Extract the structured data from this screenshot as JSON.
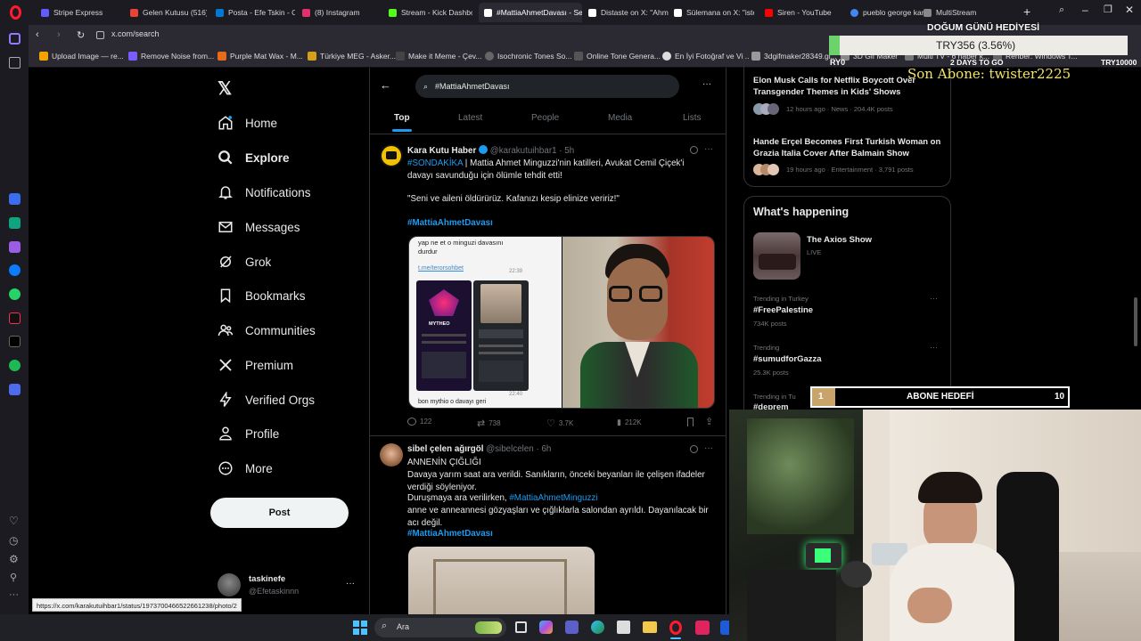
{
  "browser": {
    "tabs": [
      {
        "label": "Stripe Express",
        "color": "#635bff"
      },
      {
        "label": "Gelen Kutusu (516) -",
        "color": "#ea4335"
      },
      {
        "label": "Posta - Efe Tskin - Ou",
        "color": "#0078d4"
      },
      {
        "label": "(8) Instagram",
        "color": "#e1306c"
      },
      {
        "label": "Stream - Kick Dashbo",
        "color": "#53fc18"
      },
      {
        "label": "#MattiaAhmetDavası - Se",
        "color": "#ffffff"
      },
      {
        "label": "Distaste on X: \"Ahme",
        "color": "#ffffff"
      },
      {
        "label": "Sülemana on X: \"istec",
        "color": "#ffffff"
      },
      {
        "label": "Siren - YouTube",
        "color": "#ff0000"
      },
      {
        "label": "pueblo george kareli",
        "color": "#4285f4"
      },
      {
        "label": "MultiStream",
        "color": "#888888"
      }
    ],
    "url": "x.com/search",
    "bookmarks": [
      {
        "label": "Upload Image — re...",
        "color": "#f4a300"
      },
      {
        "label": "Remove Noise from...",
        "color": "#7a5cff"
      },
      {
        "label": "Purple Mat Wax - M...",
        "color": "#e86b1c"
      },
      {
        "label": "Türkiye MEG - Asker...",
        "color": "#d4a017"
      },
      {
        "label": "Make it Meme - Çev...",
        "color": "#444444"
      },
      {
        "label": "Isochronic Tones So...",
        "color": "#666666"
      },
      {
        "label": "Online Tone Genera...",
        "color": "#555555"
      },
      {
        "label": "En İyi Fotoğraf ve Vi...",
        "color": "#dddddd"
      },
      {
        "label": "3dgifmaker28349.gi...",
        "color": "#999999"
      },
      {
        "label": "3D Gif Maker",
        "color": "#888888"
      },
      {
        "label": "Multi TV - 6 haber k...",
        "color": "#777777"
      },
      {
        "label": "Rehber: Windows T...",
        "color": "#666666"
      }
    ],
    "status_url": "https://x.com/karakutuihbar1/status/1973700466522661238/photo/2"
  },
  "nav": {
    "items": [
      "Home",
      "Explore",
      "Notifications",
      "Messages",
      "Grok",
      "Bookmarks",
      "Communities",
      "Premium",
      "Verified Orgs",
      "Profile",
      "More"
    ],
    "post": "Post",
    "account_name": "taskinefe",
    "account_handle": "@Efetaskinnn"
  },
  "search": {
    "query": "#MattiaAhmetDavası",
    "tabs": [
      "Top",
      "Latest",
      "People",
      "Media",
      "Lists"
    ]
  },
  "tweets": [
    {
      "name": "Kara Kutu Haber",
      "handle": "@karakutuihbar1",
      "time": "· 5h",
      "hashtag_prefix": "#SONDAKİKA",
      "text1": " | Mattia Ahmet Minguzzi'nin katilleri, Avukat Cemil Çiçek'i davayı savunduğu için ölümle tehdit etti!",
      "text2": "\"Seni ve aileni öldürürüz. Kafanızı kesip elinize veririz!\"",
      "hashtag": "#MattiaAhmetDavası",
      "img_chat_line": "yap ne et o minguzi davasını durdur",
      "img_link": "t.me/terorsohbet",
      "img_time1": "22:39",
      "img_time2": "22:40",
      "img_bottom": "bon mythio o davayı geri",
      "img_brand": "MYTHEO",
      "replies": "122",
      "reposts": "738",
      "likes": "3.7K",
      "views": "212K"
    },
    {
      "name": "sibel çelen ağırgöl",
      "handle": "@sibelcelen",
      "time": "· 6h",
      "title": "ANNENİN ÇIĞLIĞI",
      "text1": "Davaya yarım saat ara verildi. Sanıkların, önceki beyanları ile çelişen ifadeler verdiği söyleniyor.",
      "text2a": "Duruşmaya ara verilirken, ",
      "mention": "#MattiaAhmetMinguzzi",
      "text2b": "anne ve anneannesi gözyaşları ve çığlıklarla salondan ayrıldı. Dayanılacak bir acı değil.",
      "hashtag": "#MattiaAhmetDavası"
    }
  ],
  "right": {
    "news": [
      {
        "title": "Elon Musk Calls for Netflix Boycott Over Transgender Themes in Kids' Shows",
        "meta": "12 hours ago · News · 204.4K posts"
      },
      {
        "title": "Hande Erçel Becomes First Turkish Woman on Grazia Italia Cover After Balmain Show",
        "meta": "19 hours ago · Entertainment · 3,791 posts"
      }
    ],
    "happening_title": "What's happening",
    "live_title": "The Axios Show",
    "live_label": "LIVE",
    "trends": [
      {
        "context": "Trending in Turkey",
        "name": "#FreePalestine",
        "posts": "734K posts"
      },
      {
        "context": "Trending",
        "name": "#sumudforGazza",
        "posts": "25.3K posts"
      },
      {
        "context": "Trending in Tu",
        "name": "#deprem",
        "posts": ""
      }
    ]
  },
  "overlay": {
    "gift_title": "DOĞUM GÜNÜ HEDİYESİ",
    "gift_amount": "TRY356 (3.56%)",
    "gift_left": "RY0",
    "gift_days": "2 DAYS TO GO",
    "gift_goal": "TRY10000",
    "last_sub": "Son Abone: twister2225",
    "sub_goal_current": "1",
    "sub_goal_label": "ABONE HEDEFİ",
    "sub_goal_target": "10",
    "gift_progress": 0.0356
  },
  "taskbar": {
    "search": "Ara"
  }
}
